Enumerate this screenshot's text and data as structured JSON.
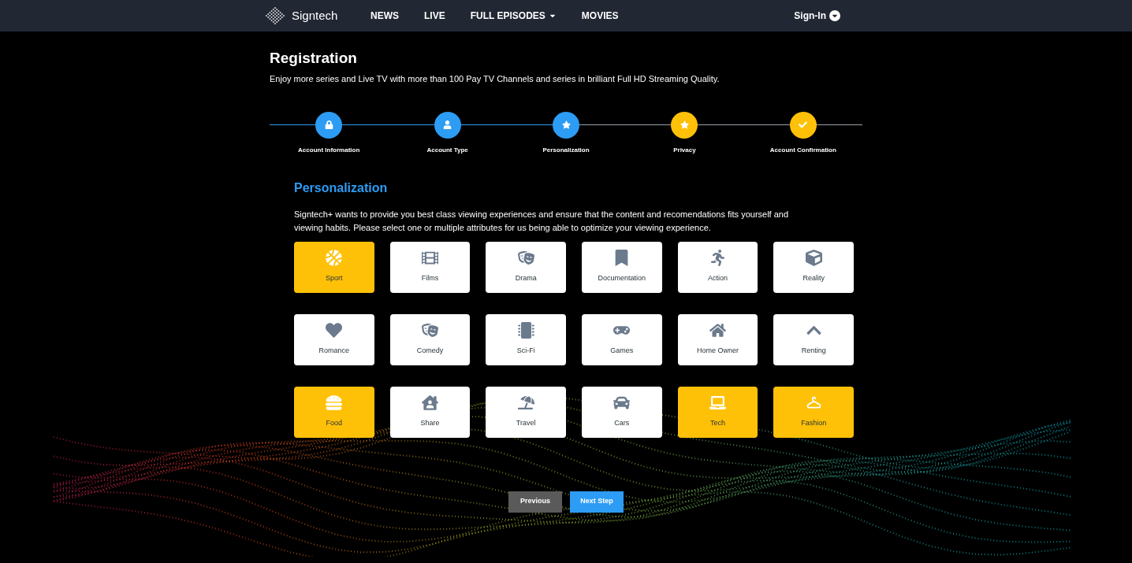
{
  "navbar": {
    "brand": "Signtech",
    "links": [
      {
        "label": "NEWS",
        "dropdown": false
      },
      {
        "label": "LIVE",
        "dropdown": false
      },
      {
        "label": "FULL EPISODES",
        "dropdown": true
      },
      {
        "label": "MOVIES",
        "dropdown": false
      }
    ],
    "sign_in": "Sign-In"
  },
  "header": {
    "title": "Registration",
    "subtitle": "Enjoy more series and Live TV with more than 100 Pay TV Channels and series in brilliant Full HD Streaming Quality."
  },
  "steps": [
    {
      "label": "Account Information",
      "color": "#2d9cf4"
    },
    {
      "label": "Account Type",
      "color": "#2d9cf4"
    },
    {
      "label": "Personalization",
      "color": "#2d9cf4"
    },
    {
      "label": "Privacy",
      "color": "#ffc107"
    },
    {
      "label": "Account Confirmation",
      "color": "#ffc107"
    }
  ],
  "section": {
    "title": "Personalization",
    "description": "Signtech+ wants to provide you best class viewing experiences and ensure that the content and recomendations fits yourself and viewing habits. Please select one or multiple attributes for us being able to optimize your viewing experience."
  },
  "attributes": [
    {
      "label": "Sport",
      "selected": true
    },
    {
      "label": "Films",
      "selected": false
    },
    {
      "label": "Drama",
      "selected": false
    },
    {
      "label": "Documentation",
      "selected": false
    },
    {
      "label": "Action",
      "selected": false
    },
    {
      "label": "Reality",
      "selected": false
    },
    {
      "label": "Romance",
      "selected": false
    },
    {
      "label": "Comedy",
      "selected": false
    },
    {
      "label": "Sci-Fi",
      "selected": false
    },
    {
      "label": "Games",
      "selected": false
    },
    {
      "label": "Home Owner",
      "selected": false
    },
    {
      "label": "Renting",
      "selected": false
    },
    {
      "label": "Food",
      "selected": true
    },
    {
      "label": "Share",
      "selected": false
    },
    {
      "label": "Travel",
      "selected": false
    },
    {
      "label": "Cars",
      "selected": false
    },
    {
      "label": "Tech",
      "selected": true
    },
    {
      "label": "Fashion",
      "selected": true
    }
  ],
  "buttons": {
    "previous": "Previous",
    "next": "Next Step"
  }
}
